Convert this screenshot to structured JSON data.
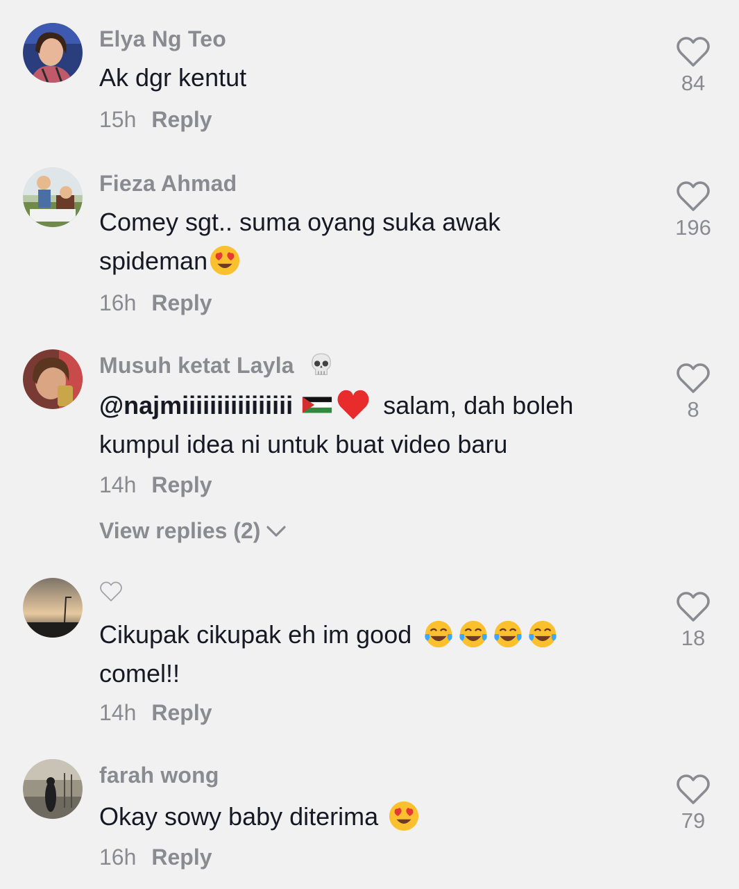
{
  "comments": [
    {
      "username": "Elya Ng Teo",
      "text": "Ak dgr kentut",
      "time": "15h",
      "reply": "Reply",
      "likes": "84",
      "avatar_icon": "avatar-photo-woman"
    },
    {
      "username": "Fieza Ahmad",
      "text_line1": "Comey sgt.. suma oyang suka awak",
      "text_line2": "spideman",
      "emoji": "heart-eyes-emoji",
      "time": "16h",
      "reply": "Reply",
      "likes": "196",
      "avatar_icon": "avatar-photo-figurines"
    },
    {
      "username": "Musuh ketat Layla",
      "username_emoji": "skull-emoji",
      "mention": "@najmiiiiiiiiiiiiiiii",
      "mention_emojis": [
        "palestine-flag-emoji",
        "red-heart-emoji"
      ],
      "text_line1": "salam, dah boleh",
      "text_line2": "kumpul idea ni untuk buat video baru",
      "time": "14h",
      "reply": "Reply",
      "likes": "8",
      "view_replies": "View replies (2)",
      "avatar_icon": "avatar-photo-boy"
    },
    {
      "username_icon": "outline-heart-icon",
      "text_line1": "Cikupak cikupak eh im good",
      "text_line2": "comel!!",
      "emoji": "tears-of-joy-emoji",
      "emoji_count": 4,
      "time": "14h",
      "reply": "Reply",
      "likes": "18",
      "avatar_icon": "avatar-photo-sunset"
    },
    {
      "username": "farah wong",
      "text": "Okay sowy baby diterima",
      "emoji": "heart-eyes-emoji",
      "time": "16h",
      "reply": "Reply",
      "likes": "79",
      "avatar_icon": "avatar-photo-street"
    }
  ],
  "colors": {
    "background": "#f1f1f2",
    "primary_text": "#161823",
    "secondary_text": "#8a8b91"
  }
}
